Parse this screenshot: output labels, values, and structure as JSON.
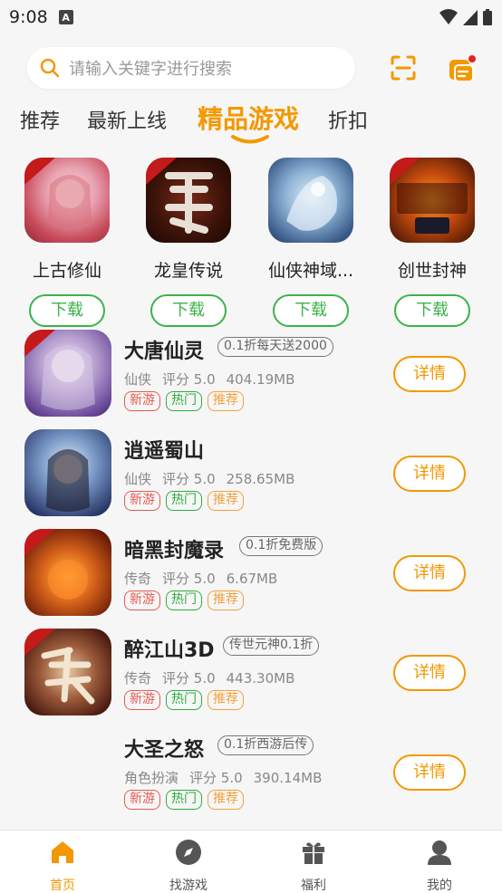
{
  "status_bar": {
    "time": "9:08",
    "notif_icon": "A"
  },
  "search": {
    "placeholder": "请输入关键字进行搜索"
  },
  "tabs": [
    {
      "label": "推荐"
    },
    {
      "label": "最新上线"
    },
    {
      "label": "精品游戏"
    },
    {
      "label": "折扣"
    }
  ],
  "featured": [
    {
      "name": "上古修仙",
      "button": "下载"
    },
    {
      "name": "龙皇传说",
      "button": "下载"
    },
    {
      "name": "仙侠神域...",
      "button": "下载"
    },
    {
      "name": "创世封神",
      "button": "下载"
    }
  ],
  "games": [
    {
      "title": "大唐仙灵",
      "tagline": "0.1折每天送2000",
      "category": "仙侠",
      "rating": "评分 5.0",
      "size": "404.19MB",
      "badges": [
        "新游",
        "热门",
        "推荐"
      ],
      "action": "详情"
    },
    {
      "title": "逍遥蜀山",
      "tagline": "",
      "category": "仙侠",
      "rating": "评分 5.0",
      "size": "258.65MB",
      "badges": [
        "新游",
        "热门",
        "推荐"
      ],
      "action": "详情"
    },
    {
      "title": "暗黑封魔录",
      "tagline": "0.1折免费版",
      "category": "传奇",
      "rating": "评分 5.0",
      "size": "6.67MB",
      "badges": [
        "新游",
        "热门",
        "推荐"
      ],
      "action": "详情"
    },
    {
      "title": "醉江山3D",
      "tagline": "传世元神0.1折",
      "category": "传奇",
      "rating": "评分 5.0",
      "size": "443.30MB",
      "badges": [
        "新游",
        "热门",
        "推荐"
      ],
      "action": "详情"
    },
    {
      "title": "大圣之怒",
      "tagline": "0.1折西游后传",
      "category": "角色扮演",
      "rating": "评分 5.0",
      "size": "390.14MB",
      "badges": [
        "新游",
        "热门",
        "推荐"
      ],
      "action": "详情"
    }
  ],
  "nav": [
    {
      "label": "首页",
      "icon": "home-icon"
    },
    {
      "label": "找游戏",
      "icon": "compass-icon"
    },
    {
      "label": "福利",
      "icon": "gift-icon"
    },
    {
      "label": "我的",
      "icon": "user-icon"
    }
  ],
  "colors": {
    "accent": "#f39800",
    "download": "#3bb34a"
  }
}
